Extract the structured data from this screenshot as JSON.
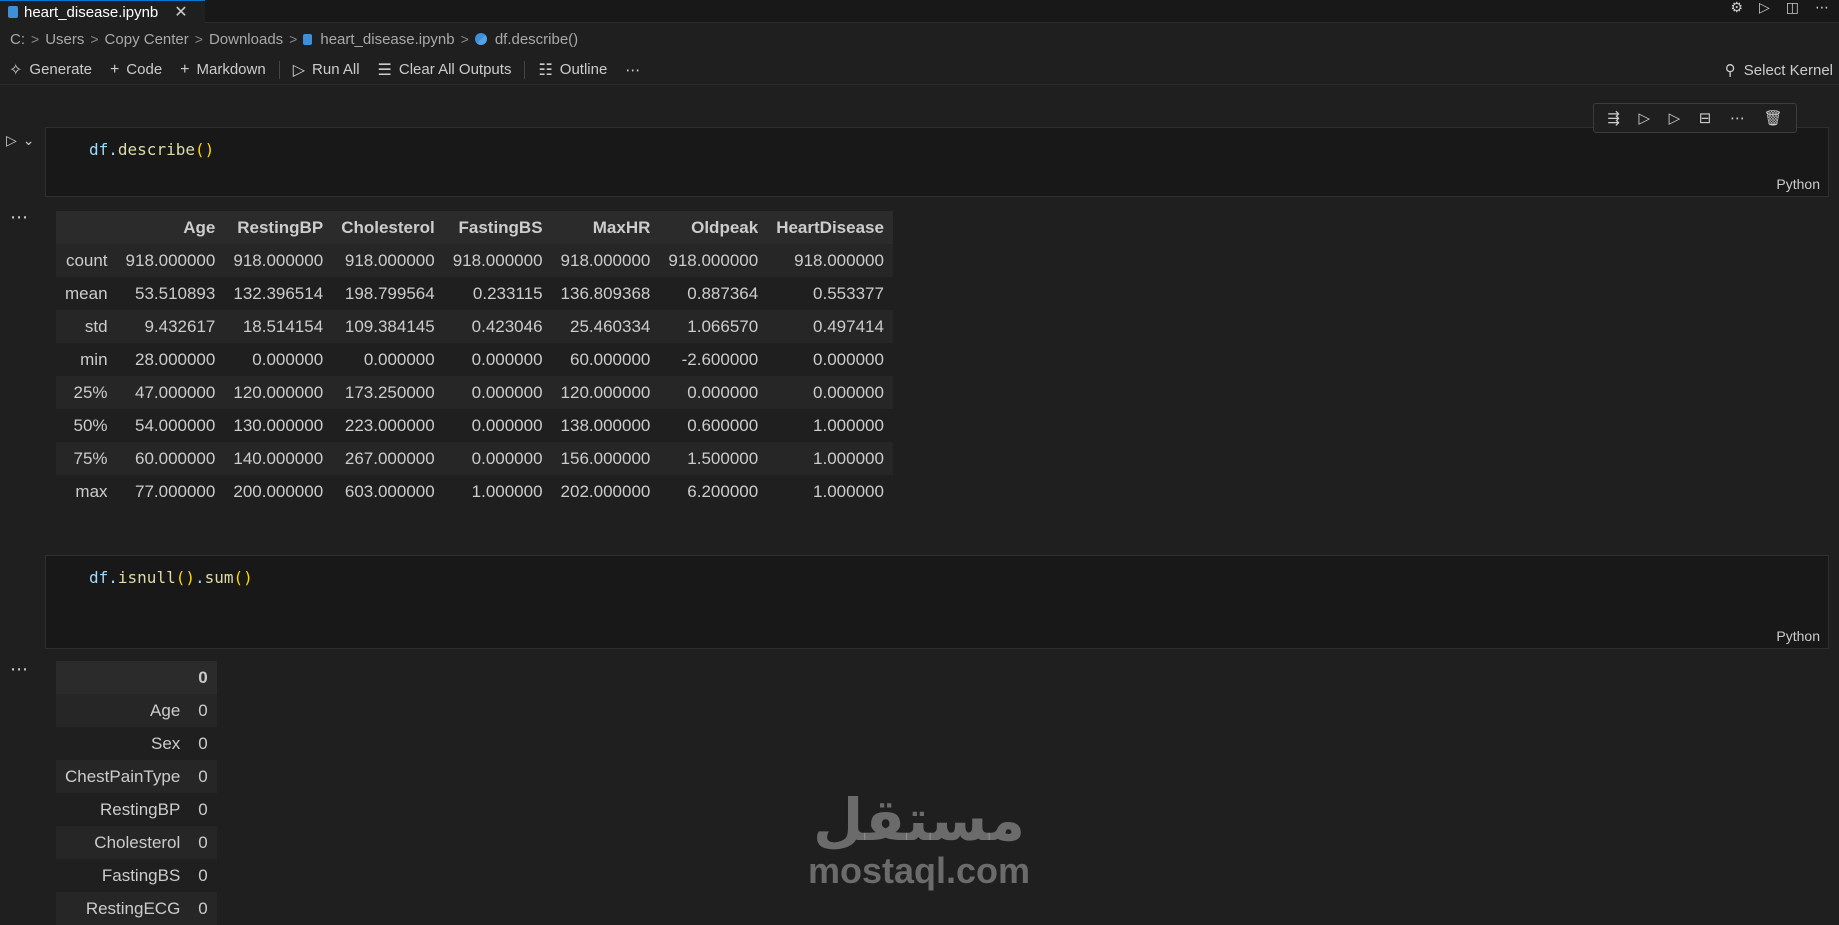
{
  "tab": {
    "title": "heart_disease.ipynb",
    "close": "✕"
  },
  "breadcrumb": [
    "C:",
    "Users",
    "Copy Center",
    "Downloads",
    "heart_disease.ipynb",
    "df.describe()"
  ],
  "toolbar": {
    "generate": "Generate",
    "code": "Code",
    "markdown": "Markdown",
    "run_all": "Run All",
    "clear_outputs": "Clear All Outputs",
    "outline": "Outline",
    "more": "⋯",
    "select_kernel": "Select Kernel"
  },
  "cells": [
    {
      "code_obj": "df",
      "code_fn": "describe",
      "language": "Python"
    },
    {
      "code_obj": "df",
      "code_fn": "isnull",
      "code_fn2": "sum",
      "language": "Python"
    }
  ],
  "describe_table": {
    "columns": [
      "",
      "Age",
      "RestingBP",
      "Cholesterol",
      "FastingBS",
      "MaxHR",
      "Oldpeak",
      "HeartDisease"
    ],
    "rows": [
      [
        "count",
        "918.000000",
        "918.000000",
        "918.000000",
        "918.000000",
        "918.000000",
        "918.000000",
        "918.000000"
      ],
      [
        "mean",
        "53.510893",
        "132.396514",
        "198.799564",
        "0.233115",
        "136.809368",
        "0.887364",
        "0.553377"
      ],
      [
        "std",
        "9.432617",
        "18.514154",
        "109.384145",
        "0.423046",
        "25.460334",
        "1.066570",
        "0.497414"
      ],
      [
        "min",
        "28.000000",
        "0.000000",
        "0.000000",
        "0.000000",
        "60.000000",
        "-2.600000",
        "0.000000"
      ],
      [
        "25%",
        "47.000000",
        "120.000000",
        "173.250000",
        "0.000000",
        "120.000000",
        "0.000000",
        "0.000000"
      ],
      [
        "50%",
        "54.000000",
        "130.000000",
        "223.000000",
        "0.000000",
        "138.000000",
        "0.600000",
        "1.000000"
      ],
      [
        "75%",
        "60.000000",
        "140.000000",
        "267.000000",
        "0.000000",
        "156.000000",
        "1.500000",
        "1.000000"
      ],
      [
        "max",
        "77.000000",
        "200.000000",
        "603.000000",
        "1.000000",
        "202.000000",
        "6.200000",
        "1.000000"
      ]
    ]
  },
  "isnull_table": {
    "columns": [
      "",
      "0"
    ],
    "rows": [
      [
        "Age",
        "0"
      ],
      [
        "Sex",
        "0"
      ],
      [
        "ChestPainType",
        "0"
      ],
      [
        "RestingBP",
        "0"
      ],
      [
        "Cholesterol",
        "0"
      ],
      [
        "FastingBS",
        "0"
      ],
      [
        "RestingECG",
        "0"
      ]
    ]
  },
  "output_more": "⋯",
  "watermark": {
    "arabic": "مستقل",
    "latin": "mostaql.com"
  }
}
